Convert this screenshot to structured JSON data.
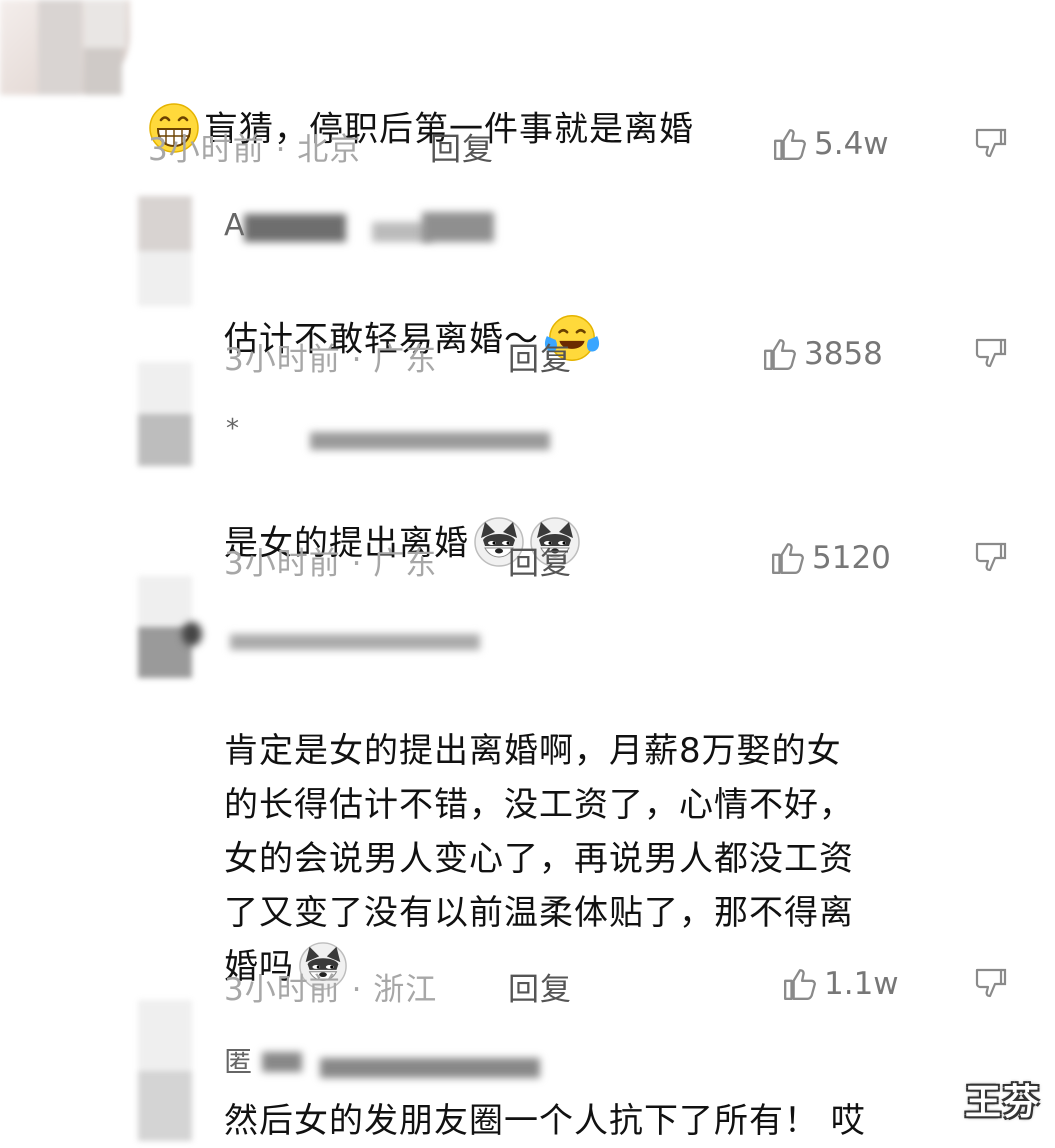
{
  "comments": [
    {
      "text": "盲猜，停职后第一件事就是离婚",
      "meta": "3小时前 · 北京",
      "reply": "回复",
      "likes": "5.4w",
      "emoji": "grinning-face"
    },
    {
      "author": "A",
      "text": "估计不敢轻易离婚～",
      "meta": "3小时前 · 广东",
      "reply": "回复",
      "likes": "3858",
      "emoji": "tears-of-joy-face"
    },
    {
      "author": "*",
      "text": "是女的提出离婚",
      "meta": "3小时前 · 广东",
      "reply": "回复",
      "likes": "5120",
      "emoji": "doge"
    },
    {
      "text": "肯定是女的提出离婚啊，月薪8万娶的女\n的长得估计不错，没工资了，心情不好，\n女的会说男人变心了，再说男人都没工资\n了又变了没有以前温柔体贴了，那不得离\n婚吗",
      "meta": "3小时前 · 浙江",
      "reply": "回复",
      "likes": "1.1w",
      "emoji": "doge"
    },
    {
      "author": "匿",
      "text": "然后女的发朋友圈一个人抗下了所有！ 哎"
    }
  ],
  "watermark": "王芬",
  "colors": {
    "meta": "#a7a7a7",
    "text": "#111111",
    "reply": "#555555"
  }
}
